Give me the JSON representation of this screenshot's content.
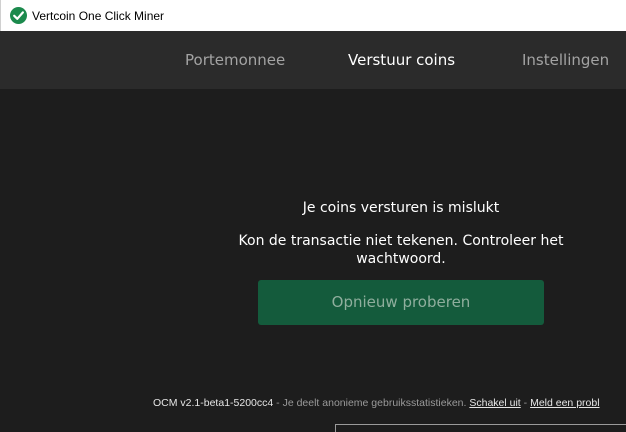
{
  "window": {
    "title": "Vertcoin One Click Miner",
    "icon": "vertcoin-check-icon",
    "accent_color": "#1c8a4d"
  },
  "nav": {
    "tabs": [
      {
        "label": "Portemonnee",
        "active": false
      },
      {
        "label": "Verstuur coins",
        "active": true
      },
      {
        "label": "Instellingen",
        "active": false
      }
    ]
  },
  "main": {
    "title": "Je coins versturen is mislukt",
    "message": "Kon de transactie niet tekenen. Controleer het wachtwoord.",
    "retry_label": "Opnieuw proberen",
    "button_color": "#145b3c"
  },
  "footer": {
    "version": "OCM v2.1-beta1-5200cc4",
    "separator1": " - ",
    "stats_text": "Je deelt anonieme gebruiksstatistieken.",
    "disable_link": "Schakel uit",
    "separator2": " - ",
    "report_link": "Meld een probl"
  }
}
